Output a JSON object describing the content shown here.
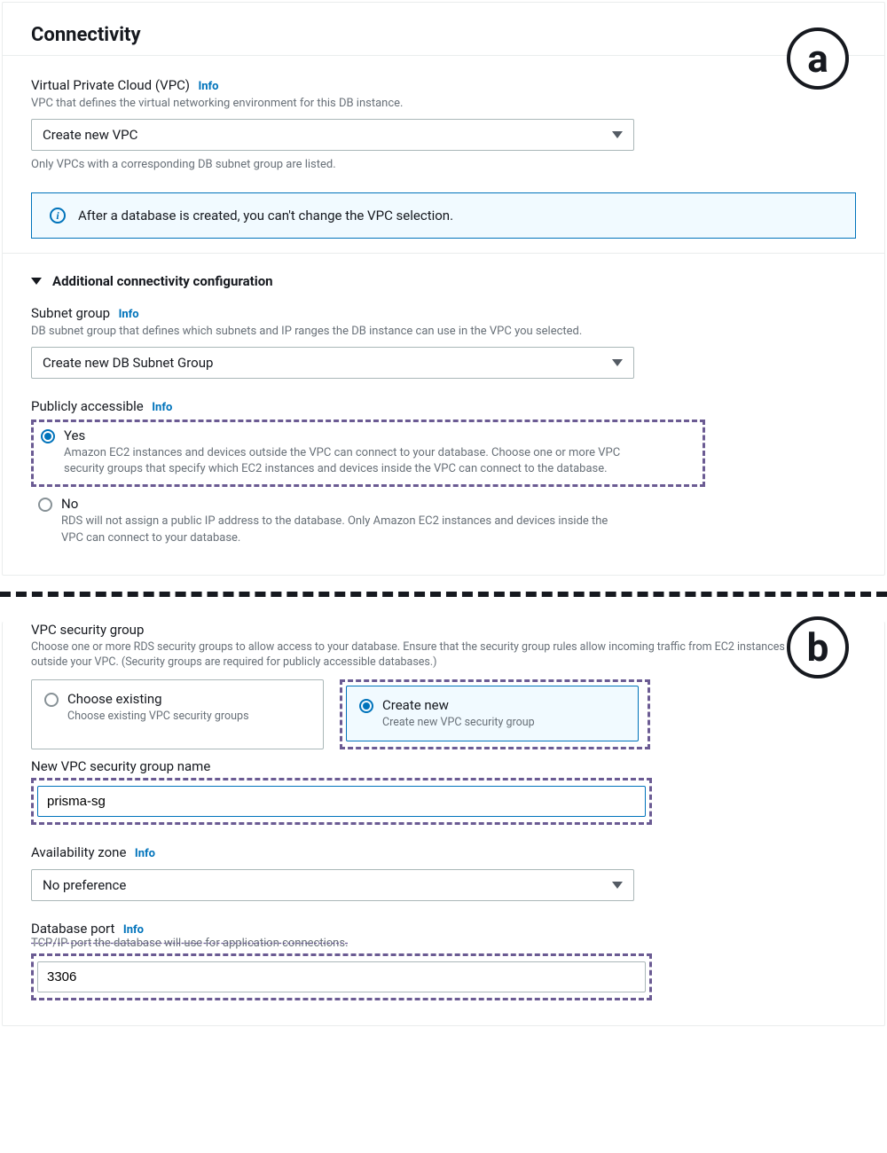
{
  "tags": {
    "a": "a",
    "b": "b"
  },
  "header": {
    "title": "Connectivity"
  },
  "vpc": {
    "label": "Virtual Private Cloud (VPC)",
    "info": "Info",
    "help": "VPC that defines the virtual networking environment for this DB instance.",
    "selected": "Create new VPC",
    "post_help": "Only VPCs with a corresponding DB subnet group are listed."
  },
  "banner": {
    "text": "After a database is created, you can't change the VPC selection."
  },
  "additional": {
    "title": "Additional connectivity configuration"
  },
  "subnet": {
    "label": "Subnet group",
    "info": "Info",
    "help": "DB subnet group that defines which subnets and IP ranges the DB instance can use in the VPC you selected.",
    "selected": "Create new DB Subnet Group"
  },
  "public": {
    "label": "Publicly accessible",
    "info": "Info",
    "yes": {
      "label": "Yes",
      "desc": "Amazon EC2 instances and devices outside the VPC can connect to your database. Choose one or more VPC security groups that specify which EC2 instances and devices inside the VPC can connect to the database."
    },
    "no": {
      "label": "No",
      "desc": "RDS will not assign a public IP address to the database. Only Amazon EC2 instances and devices inside the VPC can connect to your database."
    }
  },
  "sg": {
    "label": "VPC security group",
    "help": "Choose one or more RDS security groups to allow access to your database. Ensure that the security group rules allow incoming traffic from EC2 instances and devices outside your VPC. (Security groups are required for publicly accessible databases.)",
    "existing": {
      "title": "Choose existing",
      "desc": "Choose existing VPC security groups"
    },
    "createnew": {
      "title": "Create new",
      "desc": "Create new VPC security group"
    },
    "newname_label": "New VPC security group name",
    "newname_value": "prisma-sg"
  },
  "az": {
    "label": "Availability zone",
    "info": "Info",
    "selected": "No preference"
  },
  "port": {
    "label": "Database port",
    "info": "Info",
    "help": "TCP/IP port the database will use for application connections.",
    "value": "3306"
  }
}
